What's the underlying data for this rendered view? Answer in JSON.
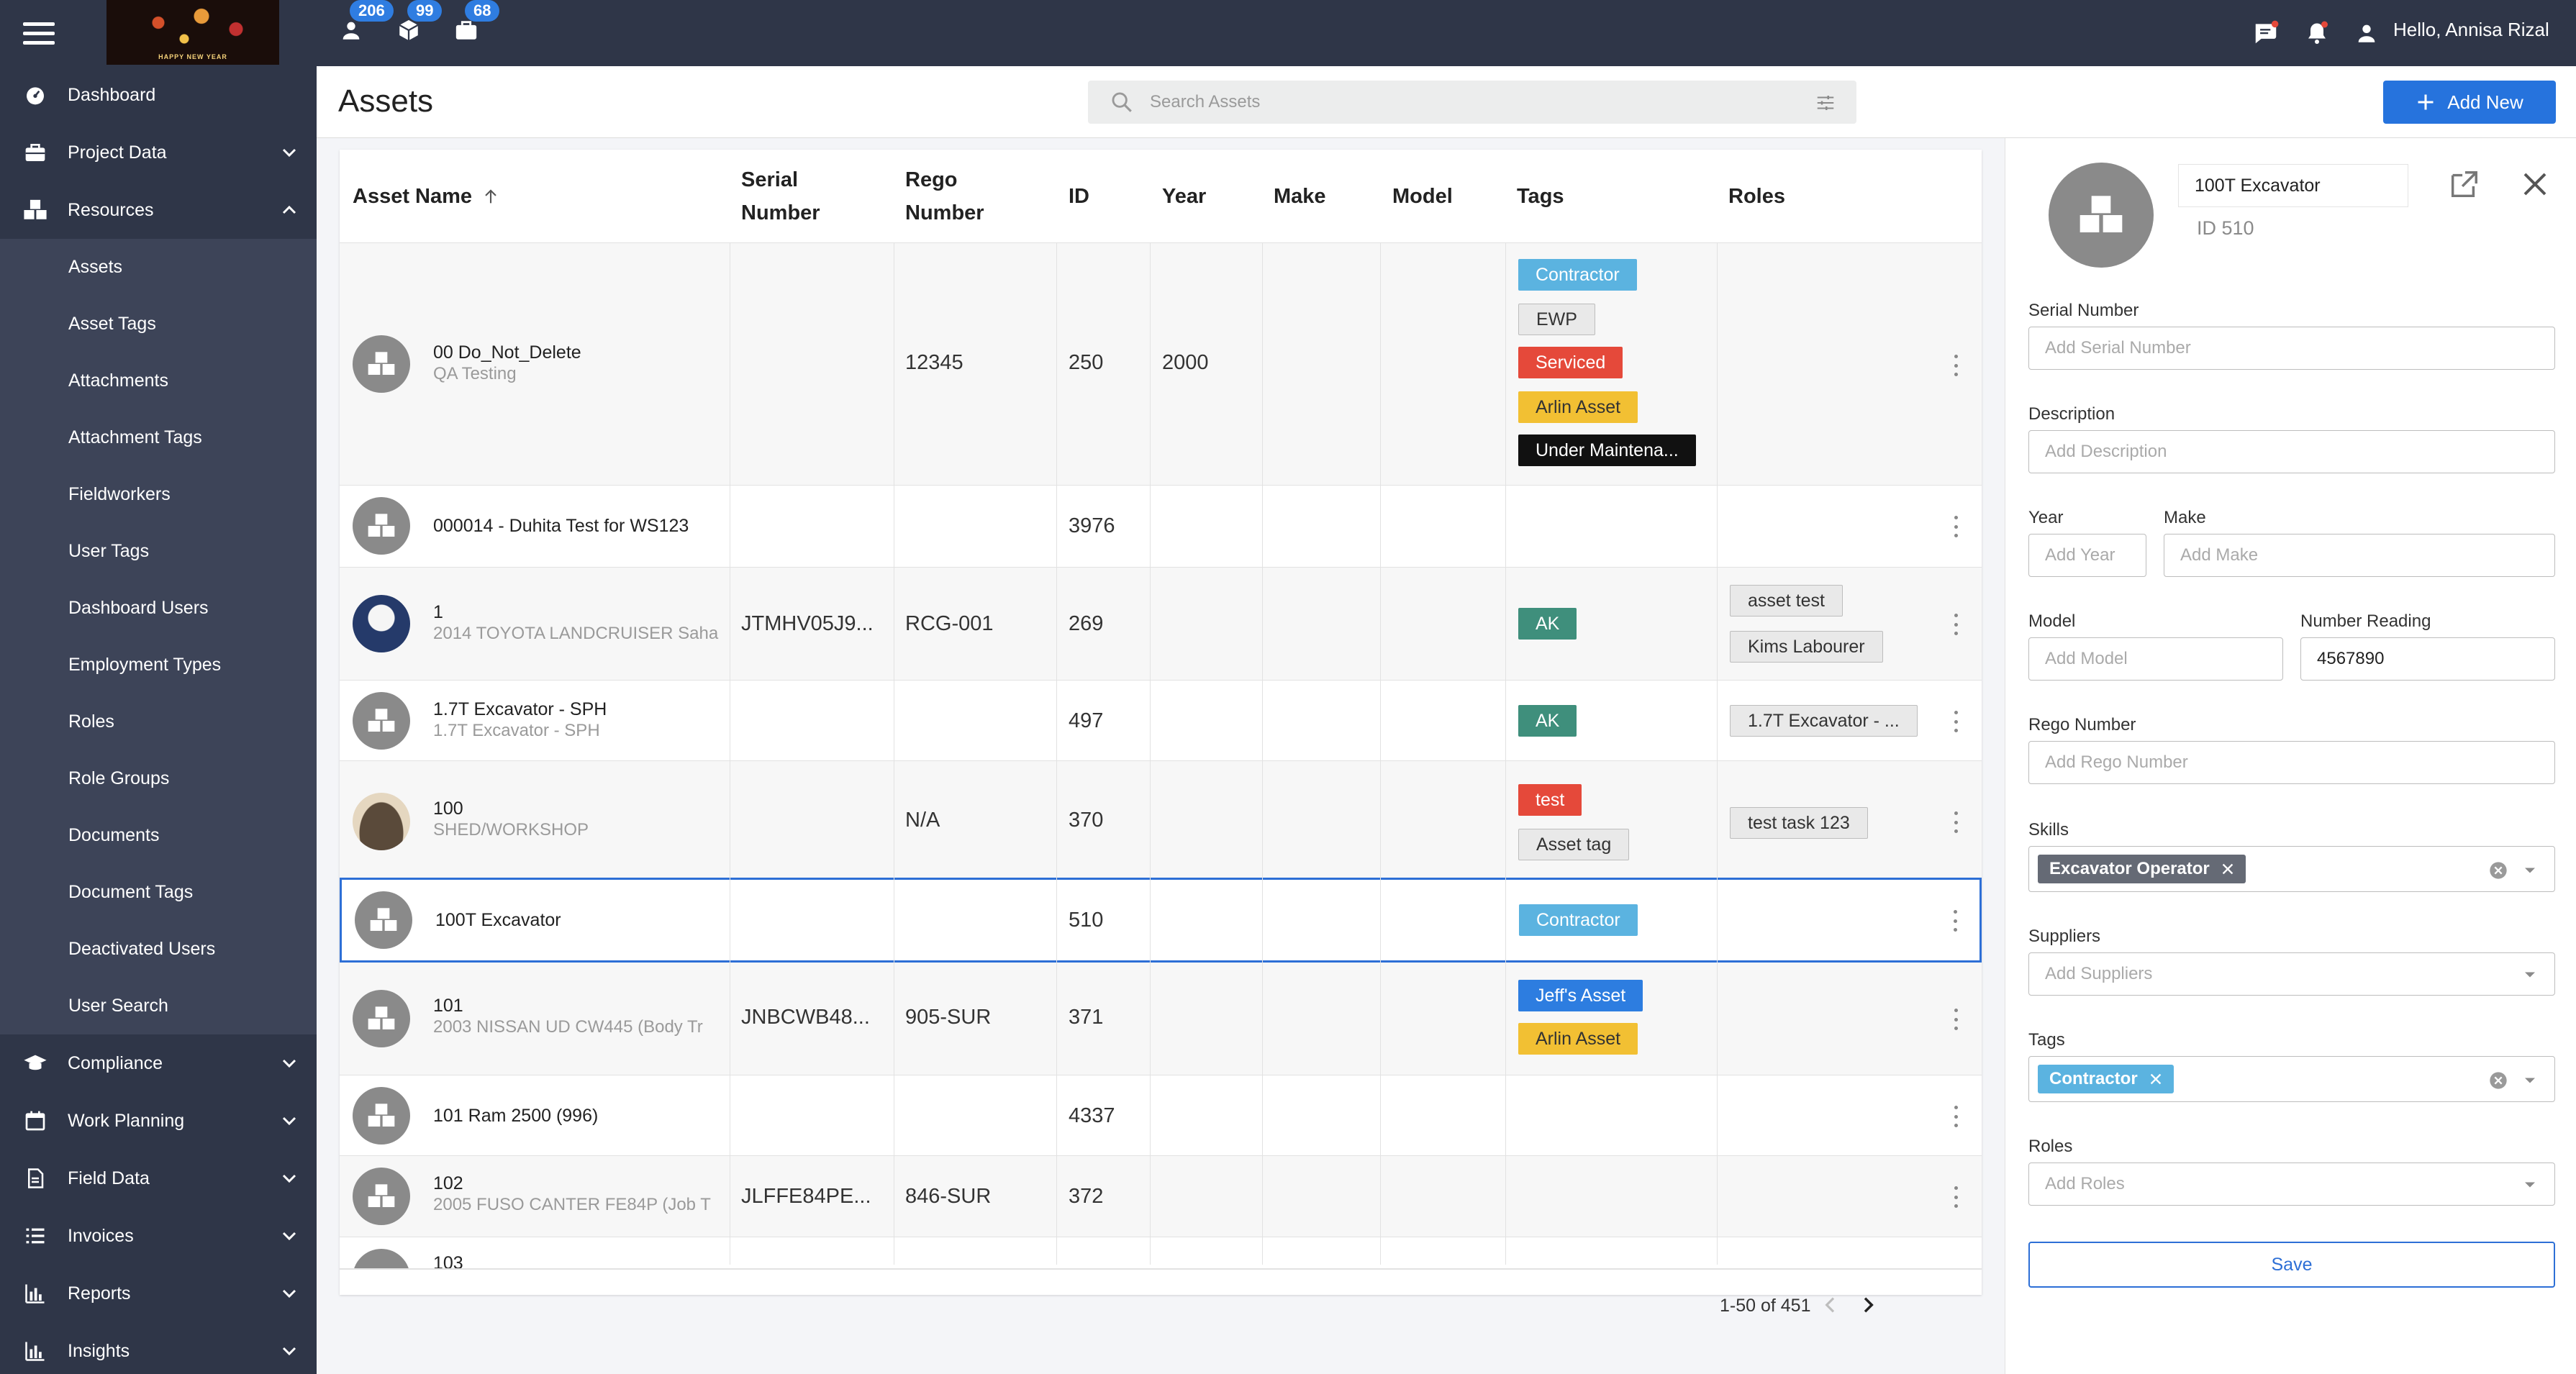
{
  "topbar": {
    "logo_text": "HAPPY NEW YEAR",
    "badges": {
      "users": "206",
      "assets": "99",
      "jobs": "68"
    },
    "greeting": "Hello, Annisa Rizal"
  },
  "sidebar": {
    "items": [
      {
        "label": "Dashboard",
        "icon": "dashboard-icon"
      },
      {
        "label": "Project Data",
        "icon": "briefcase-icon"
      },
      {
        "label": "Resources",
        "icon": "cubes-icon"
      }
    ],
    "resources_sub": [
      "Assets",
      "Asset Tags",
      "Attachments",
      "Attachment Tags",
      "Fieldworkers",
      "User Tags",
      "Dashboard Users",
      "Employment Types",
      "Roles",
      "Role Groups",
      "Documents",
      "Document Tags",
      "Deactivated Users",
      "User Search"
    ],
    "bottom_items": [
      {
        "label": "Compliance",
        "icon": "graduation-cap-icon"
      },
      {
        "label": "Work Planning",
        "icon": "calendar-icon"
      },
      {
        "label": "Field Data",
        "icon": "document-icon"
      },
      {
        "label": "Invoices",
        "icon": "list-icon"
      },
      {
        "label": "Reports",
        "icon": "bar-chart-icon"
      },
      {
        "label": "Insights",
        "icon": "bar-chart-icon"
      }
    ]
  },
  "header": {
    "title": "Assets",
    "search_placeholder": "Search Assets",
    "add_new": "Add New"
  },
  "table": {
    "columns": {
      "name": "Asset Name",
      "serial_1": "Serial",
      "serial_2": "Number",
      "rego_1": "Rego",
      "rego_2": "Number",
      "id": "ID",
      "year": "Year",
      "make": "Make",
      "model": "Model",
      "tags": "Tags",
      "roles": "Roles"
    },
    "rows": [
      {
        "name": "00 Do_Not_Delete",
        "sub": "QA Testing",
        "serial": "",
        "rego": "12345",
        "id": "250",
        "year": "2000",
        "tags": [
          "Contractor",
          "EWP",
          "Serviced",
          "Arlin Asset",
          "Under Maintena..."
        ],
        "roles": []
      },
      {
        "name": "000014 - Duhita Test for WS123",
        "sub": "",
        "serial": "",
        "rego": "",
        "id": "3976",
        "year": "",
        "tags": [],
        "roles": []
      },
      {
        "name": "1",
        "sub": "2014 TOYOTA LANDCRUISER Saha",
        "serial": "JTMHV05J9...",
        "rego": "RCG-001",
        "id": "269",
        "year": "",
        "tags": [
          "AK"
        ],
        "roles": [
          "asset test",
          "Kims Labourer"
        ]
      },
      {
        "name": "1.7T Excavator - SPH",
        "sub": "1.7T Excavator - SPH",
        "serial": "",
        "rego": "",
        "id": "497",
        "year": "",
        "tags": [
          "AK"
        ],
        "roles": [
          "1.7T Excavator - ..."
        ]
      },
      {
        "name": "100",
        "sub": "SHED/WORKSHOP",
        "serial": "",
        "rego": "N/A",
        "id": "370",
        "year": "",
        "tags": [
          "test",
          "Asset tag"
        ],
        "roles": [
          "test task 123"
        ]
      },
      {
        "name": "100T Excavator",
        "sub": "",
        "serial": "",
        "rego": "",
        "id": "510",
        "year": "",
        "tags": [
          "Contractor"
        ],
        "roles": []
      },
      {
        "name": "101",
        "sub": "2003 NISSAN UD CW445 (Body Tr",
        "serial": "JNBCWB48...",
        "rego": "905-SUR",
        "id": "371",
        "year": "",
        "tags": [
          "Jeff's Asset",
          "Arlin Asset"
        ],
        "roles": []
      },
      {
        "name": "101 Ram 2500 (996)",
        "sub": "",
        "serial": "",
        "rego": "",
        "id": "4337",
        "year": "",
        "tags": [],
        "roles": []
      },
      {
        "name": "102",
        "sub": "2005 FUSO CANTER FE84P (Job T",
        "serial": "JLFFE84PE...",
        "rego": "846-SUR",
        "id": "372",
        "year": "",
        "tags": [],
        "roles": []
      },
      {
        "name": "103",
        "sub": "",
        "serial": "",
        "rego": "",
        "id": "",
        "year": "",
        "tags": [],
        "roles": []
      }
    ],
    "pagination": "1-50 of 451"
  },
  "panel": {
    "name": "100T Excavator",
    "id_text": "ID 510",
    "serial_label": "Serial Number",
    "serial_ph": "Add Serial Number",
    "desc_label": "Description",
    "desc_ph": "Add Description",
    "year_label": "Year",
    "year_ph": "Add Year",
    "make_label": "Make",
    "make_ph": "Add Make",
    "model_label": "Model",
    "model_ph": "Add Model",
    "reading_label": "Number Reading",
    "reading_value": "4567890",
    "rego_label": "Rego Number",
    "rego_ph": "Add Rego Number",
    "skills_label": "Skills",
    "skills_chip": "Excavator Operator",
    "suppliers_label": "Suppliers",
    "suppliers_ph": "Add Suppliers",
    "tags_label": "Tags",
    "tags_chip": "Contractor",
    "roles_label": "Roles",
    "roles_ph": "Add Roles",
    "save": "Save"
  }
}
